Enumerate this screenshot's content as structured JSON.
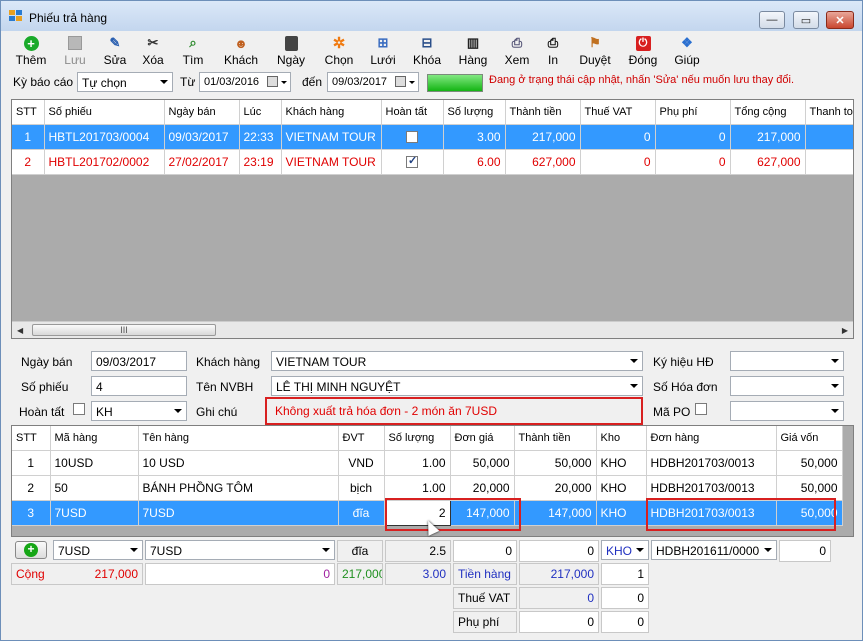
{
  "window": {
    "title": "Phiếu trả hàng"
  },
  "toolbar": {
    "them": "Thêm",
    "luu": "Lưu",
    "sua": "Sửa",
    "xoa": "Xóa",
    "tim": "Tìm",
    "khach": "Khách",
    "ngay": "Ngày",
    "chon": "Chọn",
    "luoi": "Lưới",
    "khoa": "Khóa",
    "hang": "Hàng",
    "xem": "Xem",
    "in": "In",
    "duyet": "Duyệt",
    "dong": "Đóng",
    "giup": "Giúp"
  },
  "filter": {
    "period_label": "Kỳ báo cáo",
    "period_value": "Tự chọn",
    "from_label": "Từ",
    "from_date": "01/03/2016",
    "to_label": "đến",
    "to_date": "09/03/2017",
    "status_message": "Đang ở trạng thái cập nhật, nhấn 'Sửa' nếu muốn lưu thay đổi.",
    "colors": {
      "warning": "#d00000"
    }
  },
  "receipts": {
    "columns": [
      "STT",
      "Số phiếu",
      "Ngày bán",
      "Lúc",
      "Khách hàng",
      "Hoàn tất",
      "Số lượng",
      "Thành tiền",
      "Thuế VAT",
      "Phụ phí",
      "Tổng cộng",
      "Thanh toá"
    ],
    "rows": [
      {
        "stt": "1",
        "so_phieu": "HBTL201703/0004",
        "ngay": "09/03/2017",
        "luc": "22:33",
        "khach": "VIETNAM TOUR",
        "hoan_tat": false,
        "so_luong": "3.00",
        "thanh_tien": "217,000",
        "vat": "0",
        "phu_phi": "0",
        "tong": "217,000"
      },
      {
        "stt": "2",
        "so_phieu": "HBTL201702/0002",
        "ngay": "27/02/2017",
        "luc": "23:19",
        "khach": "VIETNAM TOUR",
        "hoan_tat": true,
        "so_luong": "6.00",
        "thanh_tien": "627,000",
        "vat": "0",
        "phu_phi": "0",
        "tong": "627,000"
      }
    ],
    "scroll_label": "III"
  },
  "form": {
    "ngay_ban_label": "Ngày bán",
    "ngay_ban": "09/03/2017",
    "khach_hang_label": "Khách hàng",
    "khach_hang": "VIETNAM TOUR",
    "ky_hieu_label": "Ký hiệu HĐ",
    "ky_hieu": "",
    "so_phieu_label": "Số phiếu",
    "so_phieu": "4",
    "nvbh_label": "Tên NVBH",
    "nvbh": "LÊ THỊ MINH NGUYỆT",
    "so_hoa_don_label": "Số Hóa đơn",
    "so_hoa_don": "",
    "hoan_tat_label": "Hoàn tất",
    "kho": "KH",
    "ghi_chu_label": "Ghi chú",
    "ghi_chu": "Không xuất trả hóa đơn - 2 món ăn 7USD",
    "ma_po_label": "Mã PO",
    "ma_po": ""
  },
  "items": {
    "columns": [
      "STT",
      "Mã hàng",
      "Tên hàng",
      "ĐVT",
      "Số lượng",
      "Đơn giá",
      "Thành tiền",
      "Kho",
      "Đơn hàng",
      "Giá vốn"
    ],
    "rows": [
      {
        "stt": "1",
        "ma": "10USD",
        "ten": "10 USD",
        "dvt": "VND",
        "sl": "1.00",
        "don_gia": "50,000",
        "thanh_tien": "50,000",
        "kho": "KHO",
        "don_hang": "HDBH201703/0013",
        "gia_von": "50,000"
      },
      {
        "stt": "2",
        "ma": "50",
        "ten": "BÁNH PHỒNG TÔM",
        "dvt": "bịch",
        "sl": "1.00",
        "don_gia": "20,000",
        "thanh_tien": "20,000",
        "kho": "KHO",
        "don_hang": "HDBH201703/0013",
        "gia_von": "50,000"
      },
      {
        "stt": "3",
        "ma": "7USD",
        "ten": "7USD",
        "dvt": "đĩa",
        "sl": "2",
        "don_gia": "147,000",
        "thanh_tien": "147,000",
        "kho": "KHO",
        "don_hang": "HDBH201703/0013",
        "gia_von": "50,000"
      }
    ]
  },
  "entry": {
    "ma": "7USD",
    "ten": "7USD",
    "dvt": "đĩa",
    "sl": "2.5",
    "don_gia": "0",
    "thanh_tien": "0",
    "kho": "KHO",
    "don_hang": "HDBH201611/0000",
    "gia_von": "0"
  },
  "totals": {
    "cong_label": "Cộng",
    "cong_tien": "217,000",
    "cong_col3": "0",
    "cong_col4": "217,000",
    "cong_sl": "3.00",
    "tien_hang_label": "Tiền hàng",
    "tien_hang": "217,000",
    "tien_hang_qty": "1",
    "vat_label": "Thuế VAT",
    "vat_1": "0",
    "vat_2": "0",
    "phu_phi_label": "Phụ phí",
    "phu_phi_1": "0",
    "phu_phi_2": "0"
  }
}
